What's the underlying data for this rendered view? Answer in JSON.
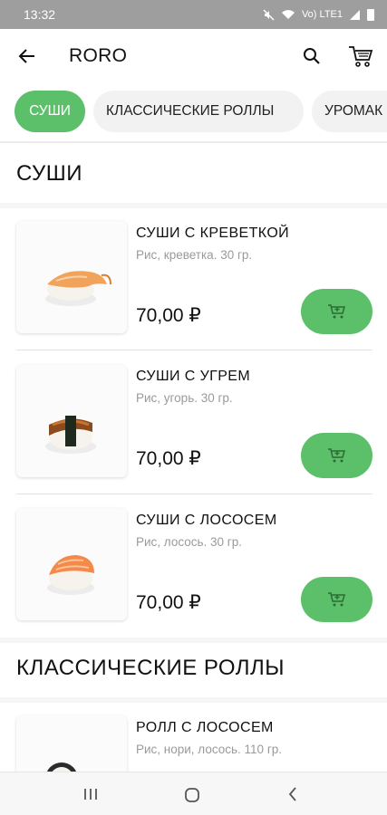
{
  "status_bar": {
    "time": "13:32",
    "network": "Vo) LTE1"
  },
  "app_bar": {
    "title": "RORO"
  },
  "categories": [
    {
      "label": "СУШИ"
    },
    {
      "label": "КЛАССИЧЕСКИЕ РОЛЛЫ"
    },
    {
      "label": "УРОМАК"
    }
  ],
  "sections": [
    {
      "title": "СУШИ",
      "products": [
        {
          "name": "СУШИ С КРЕВЕТКОЙ",
          "description": "Рис, креветка. 30 гр.",
          "price": "70,00 ₽"
        },
        {
          "name": "СУШИ С УГРЕМ",
          "description": "Рис, угорь. 30 гр.",
          "price": "70,00 ₽"
        },
        {
          "name": "СУШИ С ЛОСОСЕМ",
          "description": "Рис, лосось. 30 гр.",
          "price": "70,00 ₽"
        }
      ]
    },
    {
      "title": "КЛАССИЧЕСКИЕ РОЛЛЫ",
      "products": [
        {
          "name": "РОЛЛ С ЛОСОСЕМ",
          "description": "Рис, нори, лосось. 110 гр."
        }
      ]
    }
  ],
  "colors": {
    "accent": "#5cc06a",
    "status_bar": "#9e9e9e"
  }
}
